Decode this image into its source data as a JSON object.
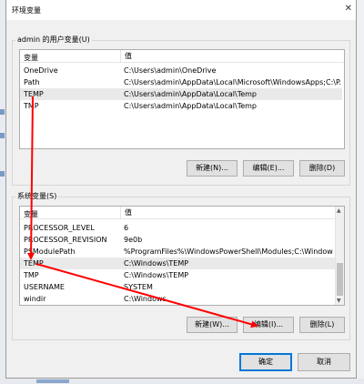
{
  "dialog": {
    "title": "环境变量"
  },
  "user_vars": {
    "group_label": "admin 的用户变量(U)",
    "columns": [
      "变量",
      "值"
    ],
    "rows": [
      {
        "name": "OneDrive",
        "value": "C:\\Users\\admin\\OneDrive"
      },
      {
        "name": "Path",
        "value": "C:\\Users\\admin\\AppData\\Local\\Microsoft\\WindowsApps;C:\\P..."
      },
      {
        "name": "TEMP",
        "value": "C:\\Users\\admin\\AppData\\Local\\Temp"
      },
      {
        "name": "TMP",
        "value": "C:\\Users\\admin\\AppData\\Local\\Temp"
      }
    ],
    "buttons": {
      "new": "新建(N)...",
      "edit": "编辑(E)...",
      "delete": "删除(D)"
    }
  },
  "system_vars": {
    "group_label": "系统变量(S)",
    "columns": [
      "变量",
      "值"
    ],
    "rows": [
      {
        "name": "PROCESSOR_LEVEL",
        "value": "6"
      },
      {
        "name": "PROCESSOR_REVISION",
        "value": "9e0b"
      },
      {
        "name": "PSModulePath",
        "value": "%ProgramFiles%\\WindowsPowerShell\\Modules;C:\\Windows\\..."
      },
      {
        "name": "TEMP",
        "value": "C:\\Windows\\TEMP"
      },
      {
        "name": "TMP",
        "value": "C:\\Windows\\TEMP"
      },
      {
        "name": "USERNAME",
        "value": "SYSTEM"
      },
      {
        "name": "windir",
        "value": "C:\\Windows"
      }
    ],
    "buttons": {
      "new": "新建(W)...",
      "edit": "编辑(I)...",
      "delete": "删除(L)"
    }
  },
  "footer": {
    "ok": "确定",
    "cancel": "取消"
  },
  "colors": {
    "arrow": "#ff0000",
    "selection": "#e9e9e9",
    "accent": "#0078d7"
  }
}
